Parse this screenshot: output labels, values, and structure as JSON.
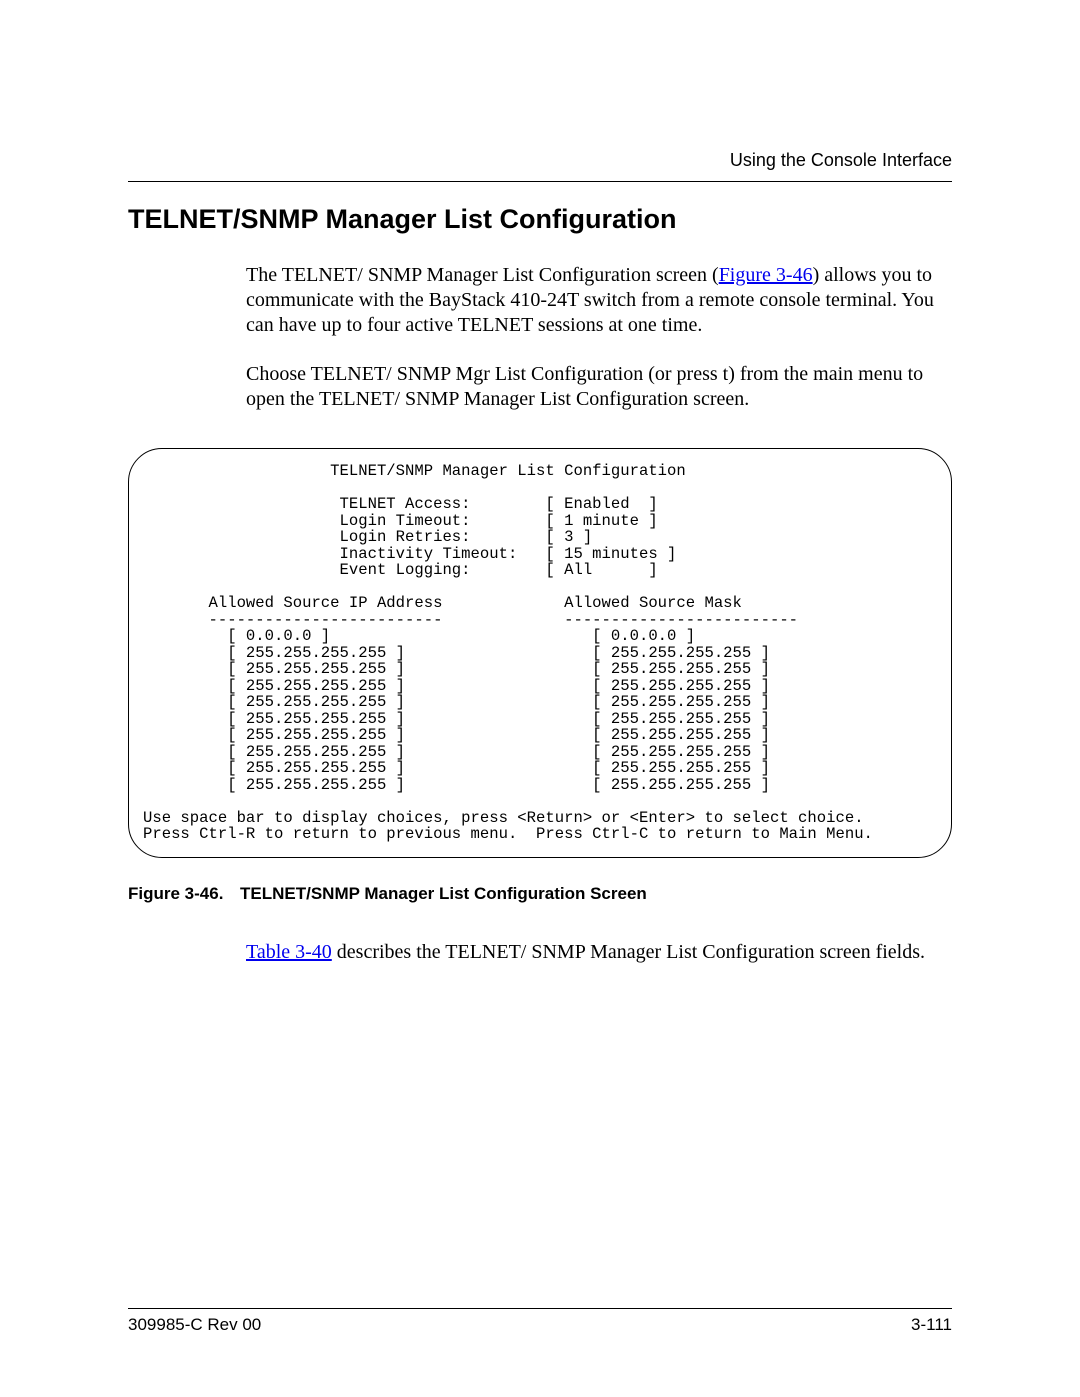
{
  "header": {
    "running_head": "Using the Console Interface"
  },
  "title": "TELNET/SNMP Manager List Configuration",
  "para1_pre": "The TELNET/ SNMP Manager List Configuration screen (",
  "para1_link": "Figure 3-46",
  "para1_post": ") allows you to communicate with the BayStack 410-24T switch from a remote console terminal. You can have up to four active TELNET sessions at one time.",
  "para2": "Choose TELNET/ SNMP Mgr List Configuration (or press t) from the main menu to open the TELNET/ SNMP Manager List Configuration screen.",
  "terminal": "                    TELNET/SNMP Manager List Configuration\n\n                     TELNET Access:        [ Enabled  ]\n                     Login Timeout:        [ 1 minute ]\n                     Login Retries:        [ 3 ]\n                     Inactivity Timeout:   [ 15 minutes ]\n                     Event Logging:        [ All      ]\n\n       Allowed Source IP Address             Allowed Source Mask\n       -------------------------             -------------------------\n         [ 0.0.0.0 ]                            [ 0.0.0.0 ]\n         [ 255.255.255.255 ]                    [ 255.255.255.255 ]\n         [ 255.255.255.255 ]                    [ 255.255.255.255 ]\n         [ 255.255.255.255 ]                    [ 255.255.255.255 ]\n         [ 255.255.255.255 ]                    [ 255.255.255.255 ]\n         [ 255.255.255.255 ]                    [ 255.255.255.255 ]\n         [ 255.255.255.255 ]                    [ 255.255.255.255 ]\n         [ 255.255.255.255 ]                    [ 255.255.255.255 ]\n         [ 255.255.255.255 ]                    [ 255.255.255.255 ]\n         [ 255.255.255.255 ]                    [ 255.255.255.255 ]\n\nUse space bar to display choices, press <Return> or <Enter> to select choice.\nPress Ctrl-R to return to previous menu.  Press Ctrl-C to return to Main Menu.",
  "figure": {
    "label": "Figure 3-46.",
    "caption": "TELNET/SNMP Manager List Configuration Screen"
  },
  "para3_link": "Table 3-40",
  "para3_post": " describes the TELNET/ SNMP Manager List Configuration screen fields.",
  "footer": {
    "left": "309985-C Rev 00",
    "right": "3-111"
  }
}
